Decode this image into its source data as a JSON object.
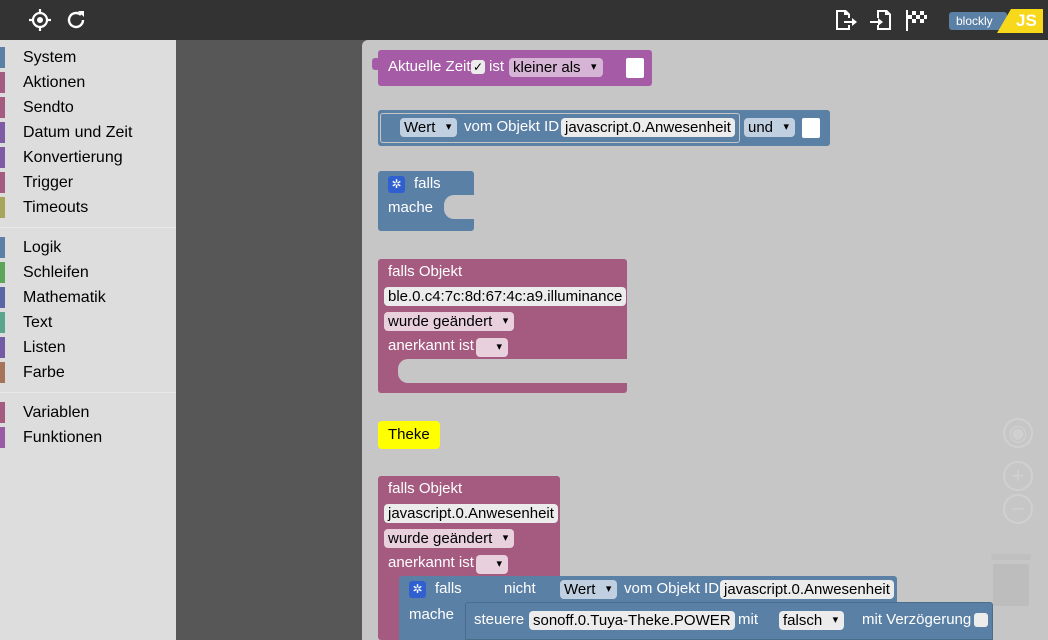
{
  "toolbar": {
    "locate_icon": "crosshair-icon",
    "reload_icon": "refresh-icon",
    "export_icon": "export-icon",
    "import_icon": "import-icon",
    "debug_icon": "checkered-flag-icon",
    "brand_blockly": "blockly",
    "brand_js": "JS"
  },
  "sidebar": {
    "groups": [
      [
        {
          "label": "System",
          "color": "#5b80a5"
        },
        {
          "label": "Aktionen",
          "color": "#a55b80"
        },
        {
          "label": "Sendto",
          "color": "#a55b80"
        },
        {
          "label": "Datum und Zeit",
          "color": "#805ba5"
        },
        {
          "label": "Konvertierung",
          "color": "#805ba5"
        },
        {
          "label": "Trigger",
          "color": "#a55b80"
        },
        {
          "label": "Timeouts",
          "color": "#a5a55b"
        }
      ],
      [
        {
          "label": "Logik",
          "color": "#5b80a5"
        },
        {
          "label": "Schleifen",
          "color": "#5ba55b"
        },
        {
          "label": "Mathematik",
          "color": "#5b67a5"
        },
        {
          "label": "Text",
          "color": "#5ba58c"
        },
        {
          "label": "Listen",
          "color": "#745ba5"
        },
        {
          "label": "Farbe",
          "color": "#a5745b"
        }
      ],
      [
        {
          "label": "Variablen",
          "color": "#a55b80"
        },
        {
          "label": "Funktionen",
          "color": "#995ba5"
        }
      ]
    ]
  },
  "blocks": {
    "time": {
      "label": "Aktuelle Zeit",
      "ist": "ist",
      "op": "kleiner als"
    },
    "value": {
      "wert": "Wert",
      "vom": "vom Objekt ID",
      "id": "javascript.0.Anwesenheit",
      "und": "und"
    },
    "if_block": {
      "falls": "falls",
      "mache": "mache"
    },
    "trigger1": {
      "title": "falls Objekt",
      "object": "ble.0.c4:7c:8d:67:4c:a9.illuminance",
      "event": "wurde geändert",
      "ack": "anerkannt ist"
    },
    "comment": {
      "text": "Theke"
    },
    "trigger2": {
      "title": "falls Objekt",
      "object": "javascript.0.Anwesenheit",
      "event": "wurde geändert",
      "ack": "anerkannt ist"
    },
    "inner_if": {
      "falls": "falls",
      "nicht": "nicht",
      "wert": "Wert",
      "vom": "vom Objekt ID",
      "id": "javascript.0.Anwesenheit",
      "mache": "mache"
    },
    "control": {
      "steuere": "steuere",
      "object": "sonoff.0.Tuya-Theke.POWER",
      "mit": "mit",
      "value": "falsch",
      "delay": "mit Verzögerung"
    }
  },
  "colors": {
    "purple": "#a55ba5",
    "blue": "#5b80a5",
    "pink": "#a55b80",
    "yellow": "#ffff00"
  }
}
